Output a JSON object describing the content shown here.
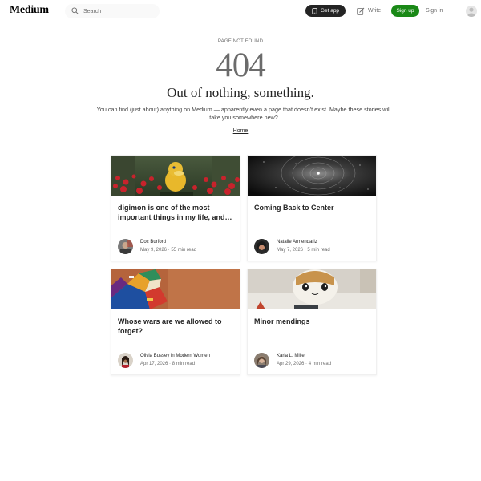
{
  "header": {
    "logo": "Medium",
    "search_placeholder": "Search",
    "get_app_label": "Get app",
    "write_label": "Write",
    "signup_label": "Sign up",
    "signin_label": "Sign in",
    "icons": {
      "search": "search-icon",
      "get_app": "phone-icon",
      "write": "write-icon",
      "avatar": "user-icon"
    }
  },
  "main": {
    "kicker": "PAGE NOT FOUND",
    "code": "404",
    "headline": "Out of nothing, something.",
    "description": "You can find (just about) anything on Medium — apparently even a page that doesn’t exist. Maybe these stories will take you somewhere new?",
    "home_link": "Home"
  },
  "cards": [
    {
      "title": "digimon is one of the most important things in my life, and…",
      "author": "Doc Burford",
      "date": "May 9, 2026",
      "read_time": "55 min read"
    },
    {
      "title": "Coming Back to Center",
      "author": "Natalie Armendariz",
      "date": "May 7, 2026",
      "read_time": "5 min read"
    },
    {
      "title": "Whose wars are we allowed to forget?",
      "author": "Olivia Bussey in Modern Women",
      "date": "Apr 17, 2026",
      "read_time": "8 min read"
    },
    {
      "title": "Minor mendings",
      "author": "Karla L. Miller",
      "date": "Apr 29, 2026",
      "read_time": "4 min read"
    }
  ],
  "colors": {
    "brand_green": "#1a8917",
    "dark_button": "#242424",
    "muted_text": "#6b6b6b"
  }
}
